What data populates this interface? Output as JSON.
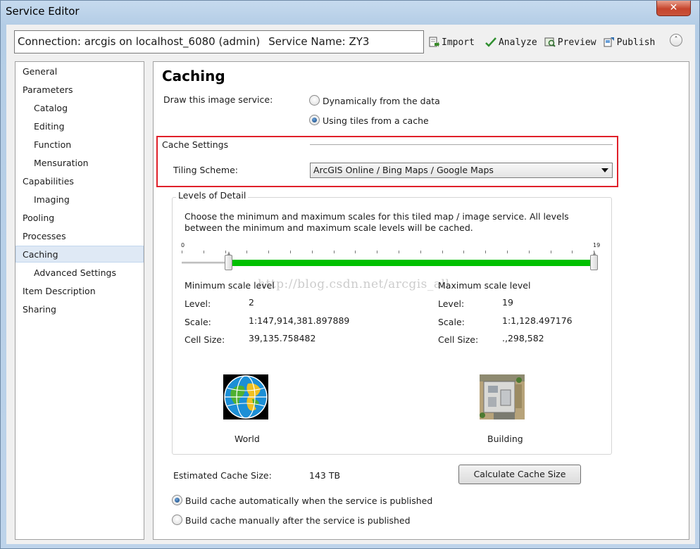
{
  "window": {
    "title": "Service Editor",
    "close_glyph": "✕"
  },
  "header": {
    "connection": "Connection: arcgis on localhost_6080 (admin)",
    "service_name": "Service Name: ZY3"
  },
  "toolbar": {
    "import_label": "Import",
    "analyze_label": "Analyze",
    "preview_label": "Preview",
    "publish_label": "Publish",
    "collapse_glyph": "˄"
  },
  "sidebar": {
    "items": [
      {
        "label": "General"
      },
      {
        "label": "Parameters"
      },
      {
        "label": "Catalog"
      },
      {
        "label": "Editing"
      },
      {
        "label": "Function"
      },
      {
        "label": "Mensuration"
      },
      {
        "label": "Capabilities"
      },
      {
        "label": "Imaging"
      },
      {
        "label": "Pooling"
      },
      {
        "label": "Processes"
      },
      {
        "label": "Caching"
      },
      {
        "label": "Advanced Settings"
      },
      {
        "label": "Item Description"
      },
      {
        "label": "Sharing"
      }
    ],
    "selected": "Caching"
  },
  "caching": {
    "title": "Caching",
    "draw_label": "Draw this image service:",
    "draw_options": [
      {
        "label": "Dynamically from the data",
        "checked": false
      },
      {
        "label": "Using tiles from a cache",
        "checked": true
      }
    ],
    "cache_settings_label": "Cache Settings",
    "tiling_scheme_label": "Tiling Scheme:",
    "tiling_scheme_value": "ArcGIS Online / Bing Maps / Google Maps",
    "lod": {
      "group_title": "Levels of Detail",
      "description": "Choose the minimum and maximum scales for this tiled map / image service. All levels between the minimum and maximum scale levels will be cached.",
      "slider_min_label": "0",
      "slider_max_label": "19",
      "slider_range_min": 0,
      "slider_range_max": 19,
      "slider_low": 2,
      "slider_high": 19,
      "watermark": "http://blog.csdn.net/arcgis_all",
      "min": {
        "heading": "Minimum scale level",
        "level_label": "Level:",
        "level": "2",
        "scale_label": "Scale:",
        "scale": "1:147,914,381.897889",
        "cell_label": "Cell Size:",
        "cell": "39,135.758482"
      },
      "max": {
        "heading": "Maximum scale level",
        "level_label": "Level:",
        "level": "19",
        "scale_label": "Scale:",
        "scale": "1:1,128.497176",
        "cell_label": "Cell Size:",
        "cell": ".,298,582"
      },
      "world_label": "World",
      "building_label": "Building"
    },
    "estimated_label": "Estimated Cache Size:",
    "estimated_value": "143 TB",
    "calculate_button": "Calculate Cache Size",
    "build_options": [
      {
        "label": "Build cache automatically when the service is published",
        "checked": true
      },
      {
        "label": "Build cache manually after the service is published",
        "checked": false
      }
    ]
  },
  "colors": {
    "highlight_box": "#e0202a",
    "slider_fill": "#00c000",
    "selected_nav": "#dfe9f5"
  }
}
